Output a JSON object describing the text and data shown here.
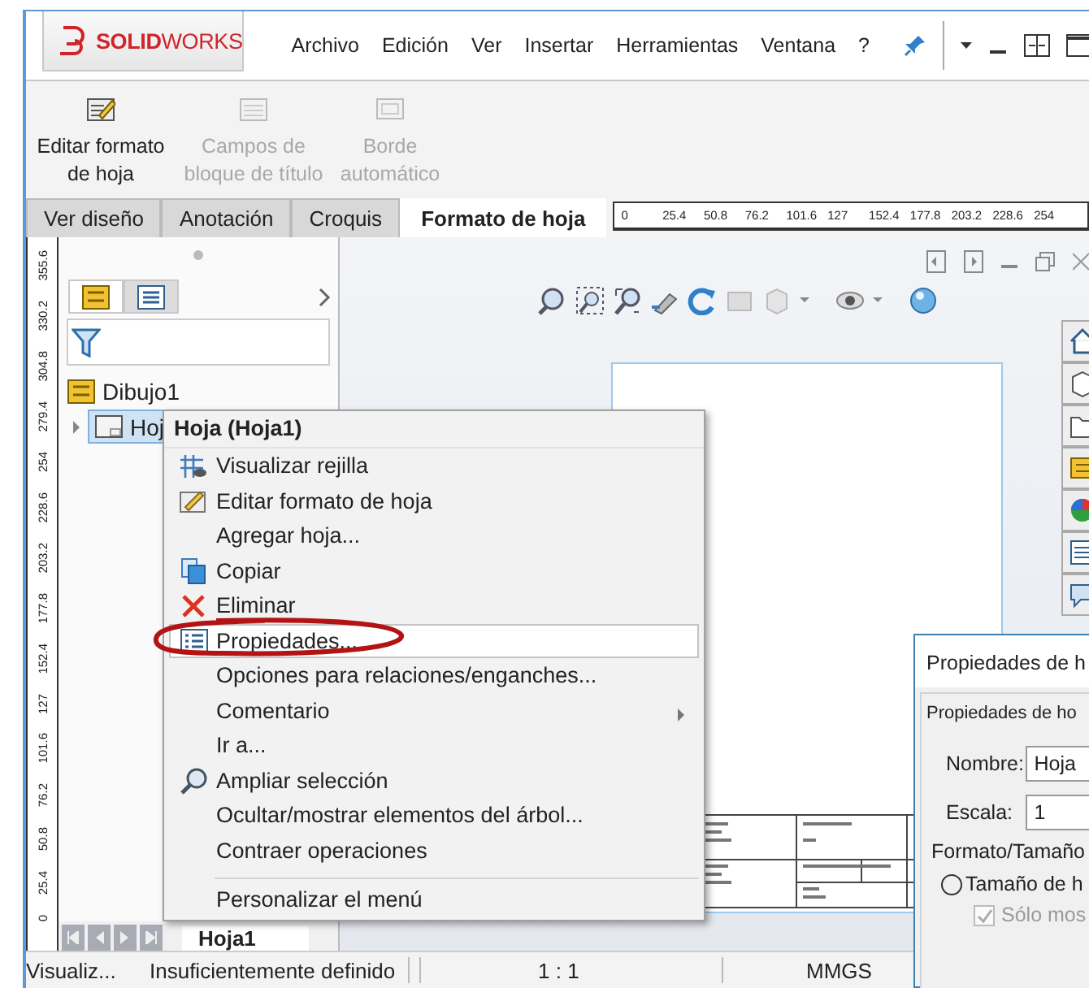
{
  "app": {
    "logo": "**SOLID**WORKS",
    "menu": [
      "Archivo",
      "Edición",
      "Ver",
      "Insertar",
      "Herramientas",
      "Ventana",
      "?"
    ]
  },
  "ribbon": [
    {
      "label": "Editar formato de hoja",
      "disabled": false
    },
    {
      "label": "Campos de bloque de título",
      "disabled": true
    },
    {
      "label": "Borde automático",
      "disabled": true
    }
  ],
  "tabs": [
    {
      "label": "Ver diseño",
      "selected": false
    },
    {
      "label": "Anotación",
      "selected": false
    },
    {
      "label": "Croquis",
      "selected": false
    },
    {
      "label": "Formato de hoja",
      "selected": true
    }
  ],
  "ruler_h": [
    "0",
    "25.4",
    "50.8",
    "76.2",
    "101.6",
    "127",
    "152.4",
    "177.8",
    "203.2",
    "228.6",
    "254"
  ],
  "ruler_v": [
    "355.6",
    "330.2",
    "304.8",
    "279.4",
    "254",
    "228.6",
    "203.2",
    "177.8",
    "152.4",
    "127",
    "101.6",
    "76.2",
    "50.8",
    "25.4",
    "0"
  ],
  "panel": {
    "tabs": [
      {
        "selected": true
      },
      {
        "selected": false
      }
    ],
    "tree": {
      "label": "Dibujo1",
      "children": [
        {
          "label": "Hoj",
          "selected": true,
          "expanded": false
        }
      ]
    },
    "sheet_tab": "Hoja1"
  },
  "context_menu": {
    "title": "Hoja (Hoja1)",
    "items": [
      {
        "label": "Visualizar rejilla",
        "selected": false,
        "submenu": false
      },
      {
        "label": "Editar formato de hoja",
        "selected": false,
        "submenu": false
      },
      {
        "label": "Agregar hoja...",
        "selected": false,
        "submenu": false
      },
      {
        "label": "Copiar",
        "selected": false,
        "submenu": false
      },
      {
        "label": "Eliminar",
        "selected": false,
        "submenu": false
      },
      {
        "label": "Propiedades...",
        "selected": true,
        "submenu": false
      },
      {
        "label": "Opciones para relaciones/enganches...",
        "selected": false,
        "submenu": false
      },
      {
        "label": "Comentario",
        "selected": false,
        "submenu": true
      },
      {
        "label": "Ir a...",
        "selected": false,
        "submenu": false
      },
      {
        "label": "Ampliar selección",
        "selected": false,
        "submenu": false
      },
      {
        "label": "Ocultar/mostrar elementos del árbol...",
        "selected": false,
        "submenu": false
      },
      {
        "label": "Contraer operaciones",
        "selected": false,
        "submenu": false
      }
    ],
    "footer": "Personalizar el menú"
  },
  "dialog": {
    "title": "Propiedades de h",
    "section": "Propiedades de ho",
    "fields": [
      {
        "label": "Nombre:",
        "value": "Hoja"
      },
      {
        "label": "Escala:",
        "value": "1"
      }
    ],
    "group": "Formato/Tamaño",
    "radio": {
      "label": "Tamaño de h",
      "selected": false
    },
    "checkbox": {
      "label": "Sólo mos",
      "checked": true,
      "disabled": true
    }
  },
  "status_bar": [
    "Visualiz...",
    "Insuficientemente definido",
    "1 : 1",
    "MMGS"
  ]
}
